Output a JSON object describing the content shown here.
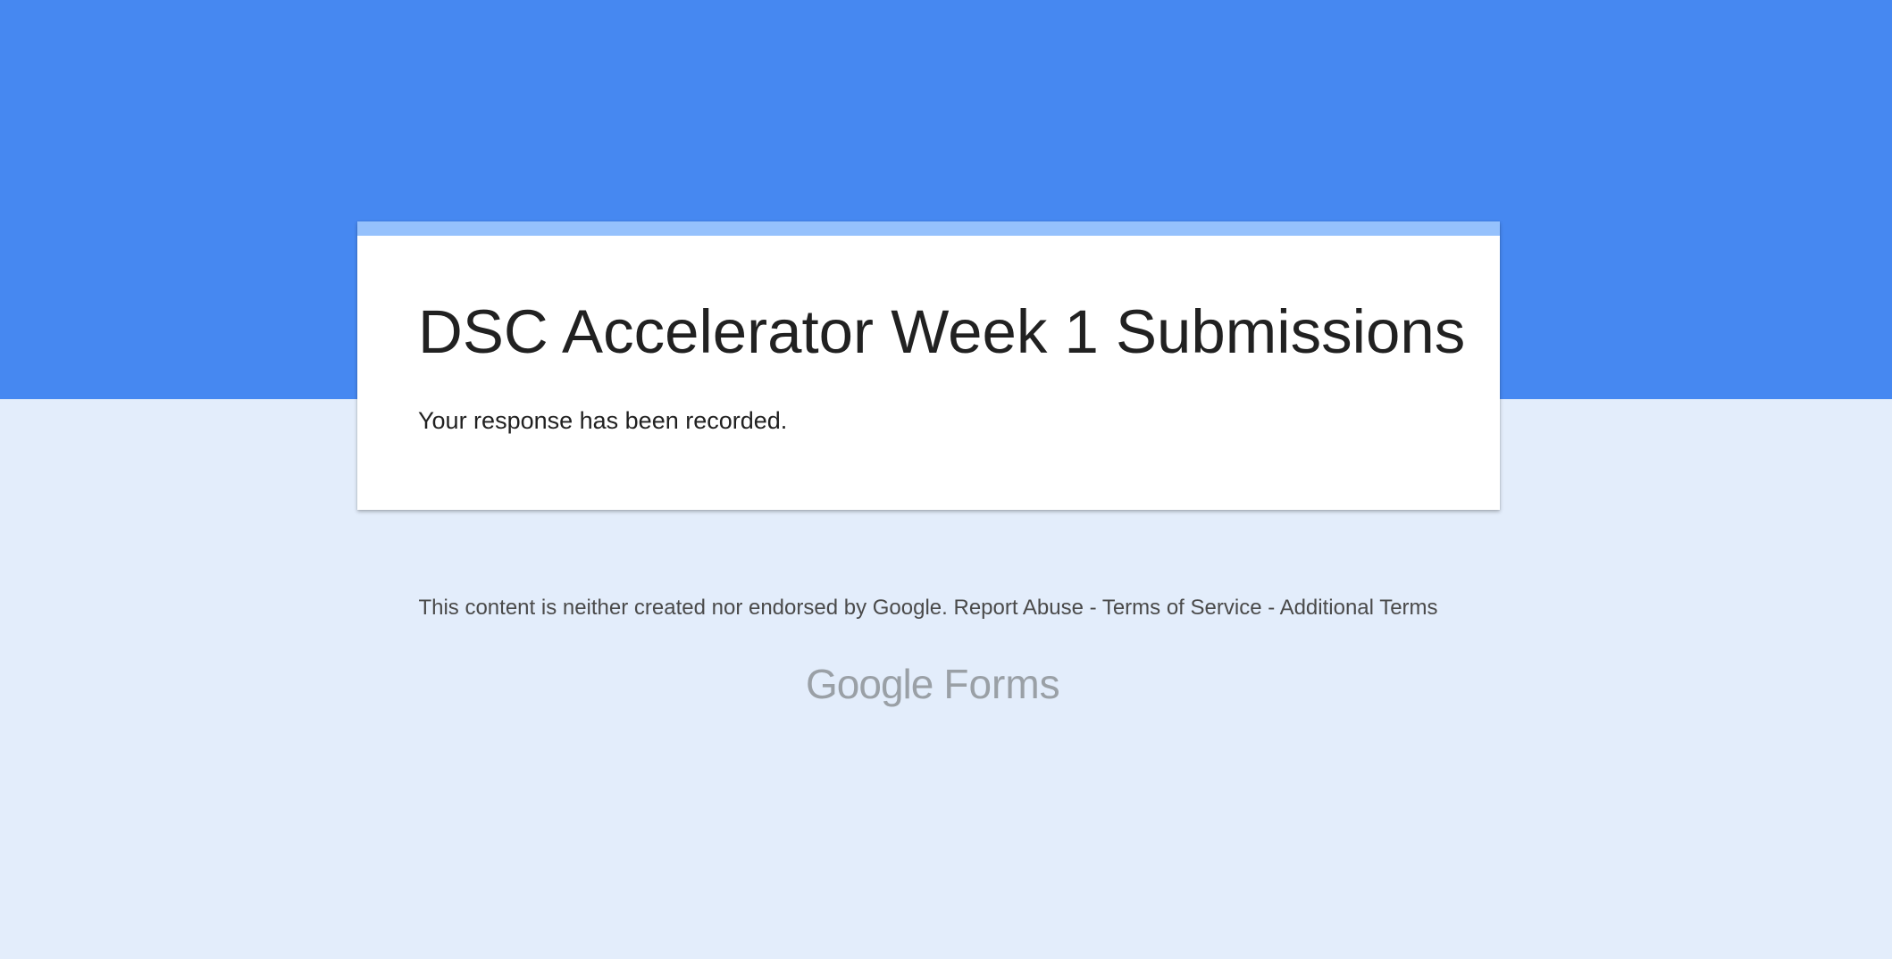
{
  "colors": {
    "header_band": "#4688f1",
    "page_background": "#e3edfb",
    "card_accent": "#95c1fc",
    "card_background": "#ffffff"
  },
  "form": {
    "title": "DSC Accelerator Week 1 Submissions",
    "confirmation_message": "Your response has been recorded."
  },
  "footer": {
    "disclaimer": "This content is neither created nor endorsed by Google.",
    "links": {
      "report_abuse": "Report Abuse",
      "terms_of_service": "Terms of Service",
      "additional_terms": "Additional Terms"
    },
    "separator": "-"
  },
  "logo": {
    "brand": "Google",
    "product": "Forms"
  }
}
